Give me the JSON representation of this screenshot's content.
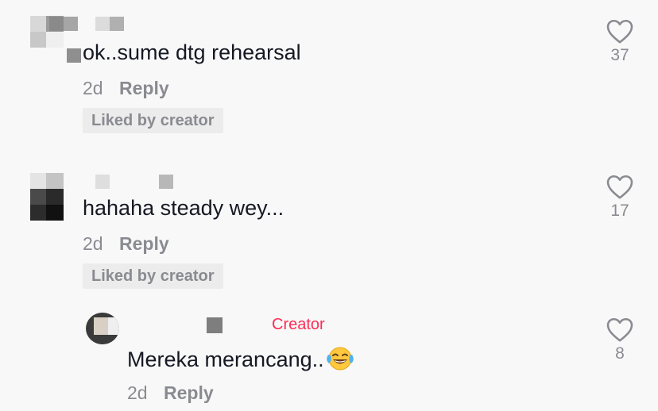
{
  "comments": [
    {
      "text": "ok..sume dtg rehearsal",
      "time": "2d",
      "reply_label": "Reply",
      "badge": "Liked by creator",
      "likes": "37"
    },
    {
      "text": "hahaha steady wey...",
      "time": "2d",
      "reply_label": "Reply",
      "badge": "Liked by creator",
      "likes": "17"
    }
  ],
  "reply": {
    "creator_label": "Creator",
    "text": "Mereka merancang..",
    "emoji": "face-with-tears-of-joy",
    "time": "2d",
    "reply_label": "Reply",
    "likes": "8"
  },
  "colors": {
    "accent": "#fe2c55",
    "muted": "#8a8b91",
    "text": "#161823",
    "background": "#f8f8f8"
  }
}
